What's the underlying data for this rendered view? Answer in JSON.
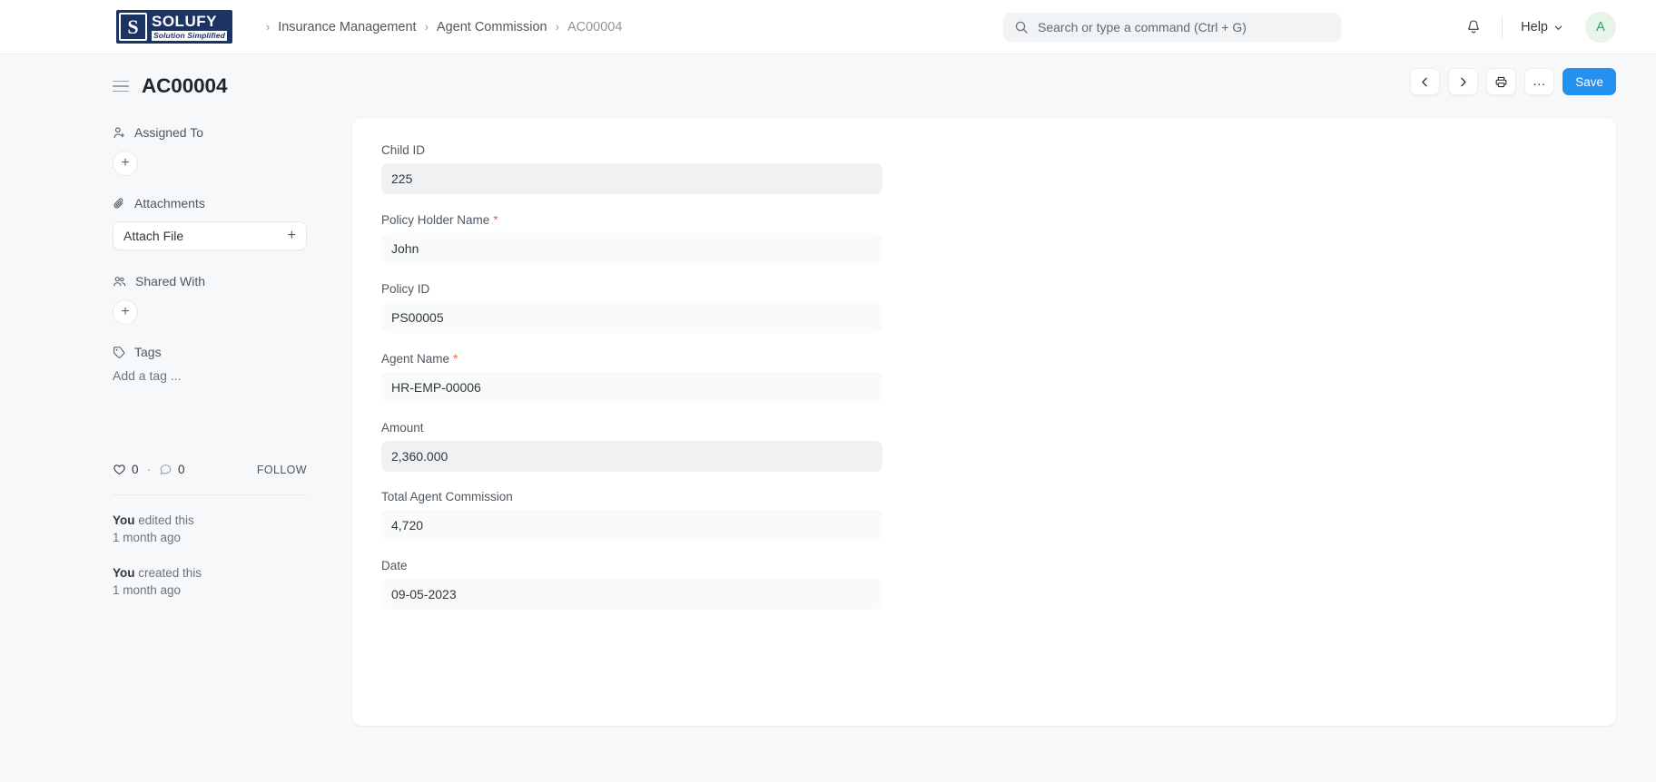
{
  "navbar": {
    "logo": {
      "mark": "S",
      "title": "SOLUFY",
      "tagline": "Solution Simplified"
    },
    "breadcrumb": [
      {
        "label": "Insurance Management",
        "last": false
      },
      {
        "label": "Agent Commission",
        "last": false
      },
      {
        "label": "AC00004",
        "last": true
      }
    ],
    "separator": "›",
    "search": {
      "placeholder": "Search or type a command (Ctrl + G)",
      "value": ""
    },
    "help_label": "Help",
    "avatar_initial": "A"
  },
  "page": {
    "title": "AC00004",
    "actions": {
      "prev_label": "‹",
      "next_label": "›",
      "more_label": "…",
      "save_label": "Save"
    }
  },
  "sidebar": {
    "assigned_to": {
      "title": "Assigned To",
      "add_label": "+"
    },
    "attachments": {
      "title": "Attachments",
      "attach_label": "Attach File",
      "add_label": "+"
    },
    "shared_with": {
      "title": "Shared With",
      "add_label": "+"
    },
    "tags": {
      "title": "Tags",
      "add_tag_label": "Add a tag ..."
    },
    "social": {
      "likes": "0",
      "separator": "·",
      "comments": "0",
      "follow_label": "FOLLOW"
    },
    "activity": [
      {
        "who": "You",
        "action": " edited this",
        "time": "1 month ago"
      },
      {
        "who": "You",
        "action": " created this",
        "time": "1 month ago"
      }
    ]
  },
  "form": {
    "fields": [
      {
        "label": "Child ID",
        "value": "225",
        "required": false,
        "readonly": true
      },
      {
        "label": "Policy Holder Name",
        "value": "John",
        "required": true,
        "readonly": false
      },
      {
        "label": "Policy ID",
        "value": "PS00005",
        "required": false,
        "readonly": false
      },
      {
        "label": "Agent Name",
        "value": "HR-EMP-00006",
        "required": true,
        "readonly": false
      },
      {
        "label": "Amount",
        "value": "2,360.000",
        "required": false,
        "readonly": true
      },
      {
        "label": "Total Agent Commission",
        "value": "4,720",
        "required": false,
        "readonly": false
      },
      {
        "label": "Date",
        "value": "09-05-2023",
        "required": false,
        "readonly": false
      }
    ]
  },
  "colors": {
    "accent": "#2490ef",
    "logo_navy": "#1b3464",
    "required_red": "#e8684a",
    "avatar_bg": "#e6f4ea",
    "avatar_fg": "#3c9a5f"
  }
}
